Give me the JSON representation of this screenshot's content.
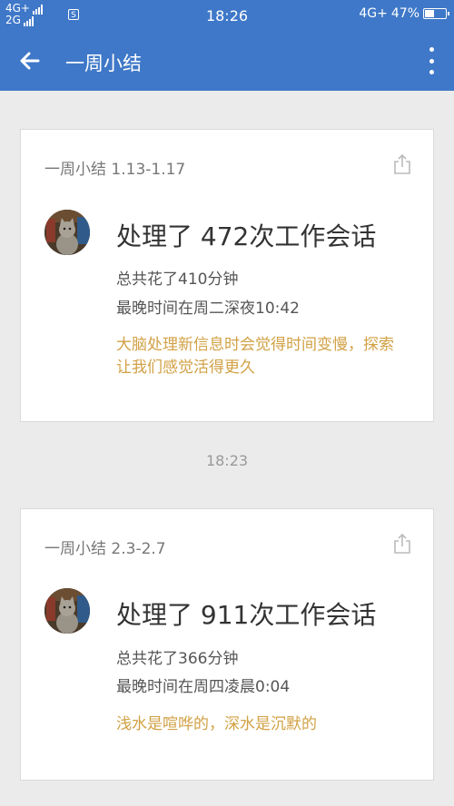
{
  "status": {
    "net1": "4G+",
    "net2": "2G",
    "sim_icon": "S",
    "time": "18:26",
    "net_right": "4G+",
    "battery": "47%",
    "battery_level": 0.47
  },
  "appbar": {
    "title": "一周小结"
  },
  "cards": [
    {
      "title": "一周小结 1.13-1.17",
      "headline": "处理了 472次工作会话",
      "line1": "总共花了410分钟",
      "line2": "最晚时间在周二深夜10:42",
      "quote": "大脑处理新信息时会觉得时间变慢，探索让我们感觉活得更久"
    },
    {
      "title": "一周小结 2.3-2.7",
      "headline": "处理了 911次工作会话",
      "line1": "总共花了366分钟",
      "line2": "最晚时间在周四凌晨0:04",
      "quote": "浅水是喧哗的，深水是沉默的"
    }
  ],
  "timestamp": "18:23",
  "colors": {
    "header": "#3f78c8",
    "quote": "#d1a145",
    "background": "#ebebeb"
  }
}
